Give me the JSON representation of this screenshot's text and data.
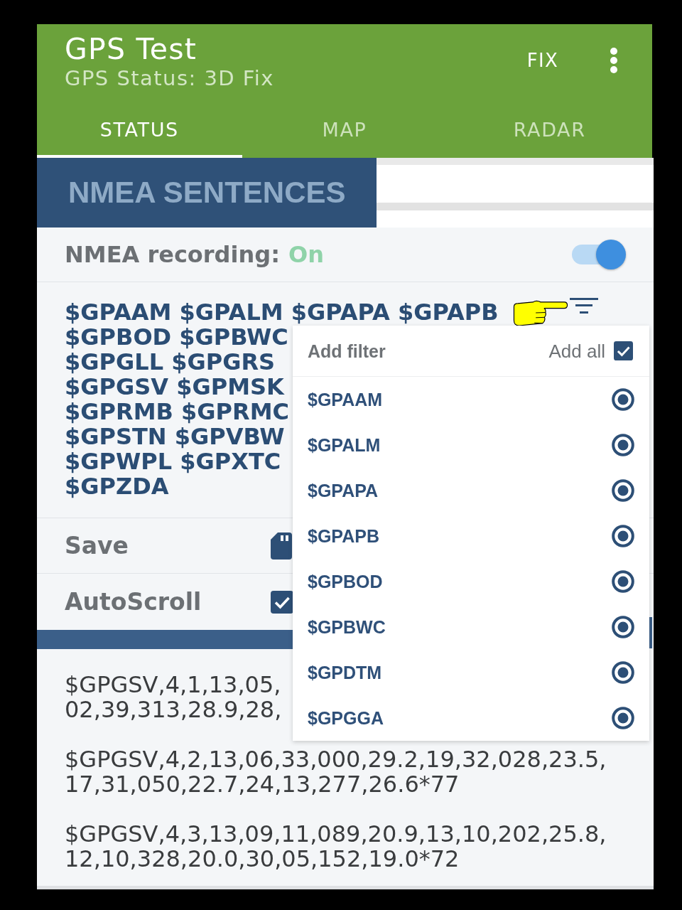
{
  "app_bar": {
    "title": "GPS Test",
    "subtitle": "GPS Status: 3D Fix",
    "action": "FIX"
  },
  "tabs": [
    {
      "label": "STATUS",
      "selected": true
    },
    {
      "label": "MAP",
      "selected": false
    },
    {
      "label": "RADAR",
      "selected": false
    }
  ],
  "section_title": "NMEA SENTENCES",
  "recording": {
    "label": "NMEA recording:",
    "value": "On",
    "on": true
  },
  "sentence_lines": [
    "$GPAAM $GPALM $GPAPA $GPAPB",
    "$GPBOD $GPBWC",
    "$GPGLL $GPGRS",
    "$GPGSV $GPMSK",
    "$GPRMB $GPRMC",
    "$GPSTN $GPVBW",
    "$GPWPL $GPXTC",
    "$GPZDA"
  ],
  "options": [
    {
      "kind": "save",
      "label": "Save"
    },
    {
      "kind": "checkbox",
      "label": "AutoScroll",
      "checked": true
    }
  ],
  "log": [
    {
      "lines": [
        "$GPGSV,4,1,13,05,",
        "02,39,313,28.9,28,"
      ]
    },
    {
      "lines": [
        "$GPGSV,4,2,13,06,33,000,29.2,19,32,028,23.5,",
        "17,31,050,22.7,24,13,277,26.6*77"
      ]
    },
    {
      "lines": [
        "$GPGSV,4,3,13,09,11,089,20.9,13,10,202,25.8,",
        "12,10,328,20.0,30,05,152,19.0*72"
      ]
    }
  ],
  "filter_menu": {
    "title": "Add filter",
    "add_all": {
      "label": "Add all",
      "checked": true
    },
    "items": [
      {
        "label": "$GPAAM",
        "checked": true
      },
      {
        "label": "$GPALM",
        "checked": true
      },
      {
        "label": "$GPAPA",
        "checked": true
      },
      {
        "label": "$GPAPB",
        "checked": true
      },
      {
        "label": "$GPBOD",
        "checked": true
      },
      {
        "label": "$GPBWC",
        "checked": true
      },
      {
        "label": "$GPDTM",
        "checked": true
      },
      {
        "label": "$GPGGA",
        "checked": true
      }
    ]
  }
}
